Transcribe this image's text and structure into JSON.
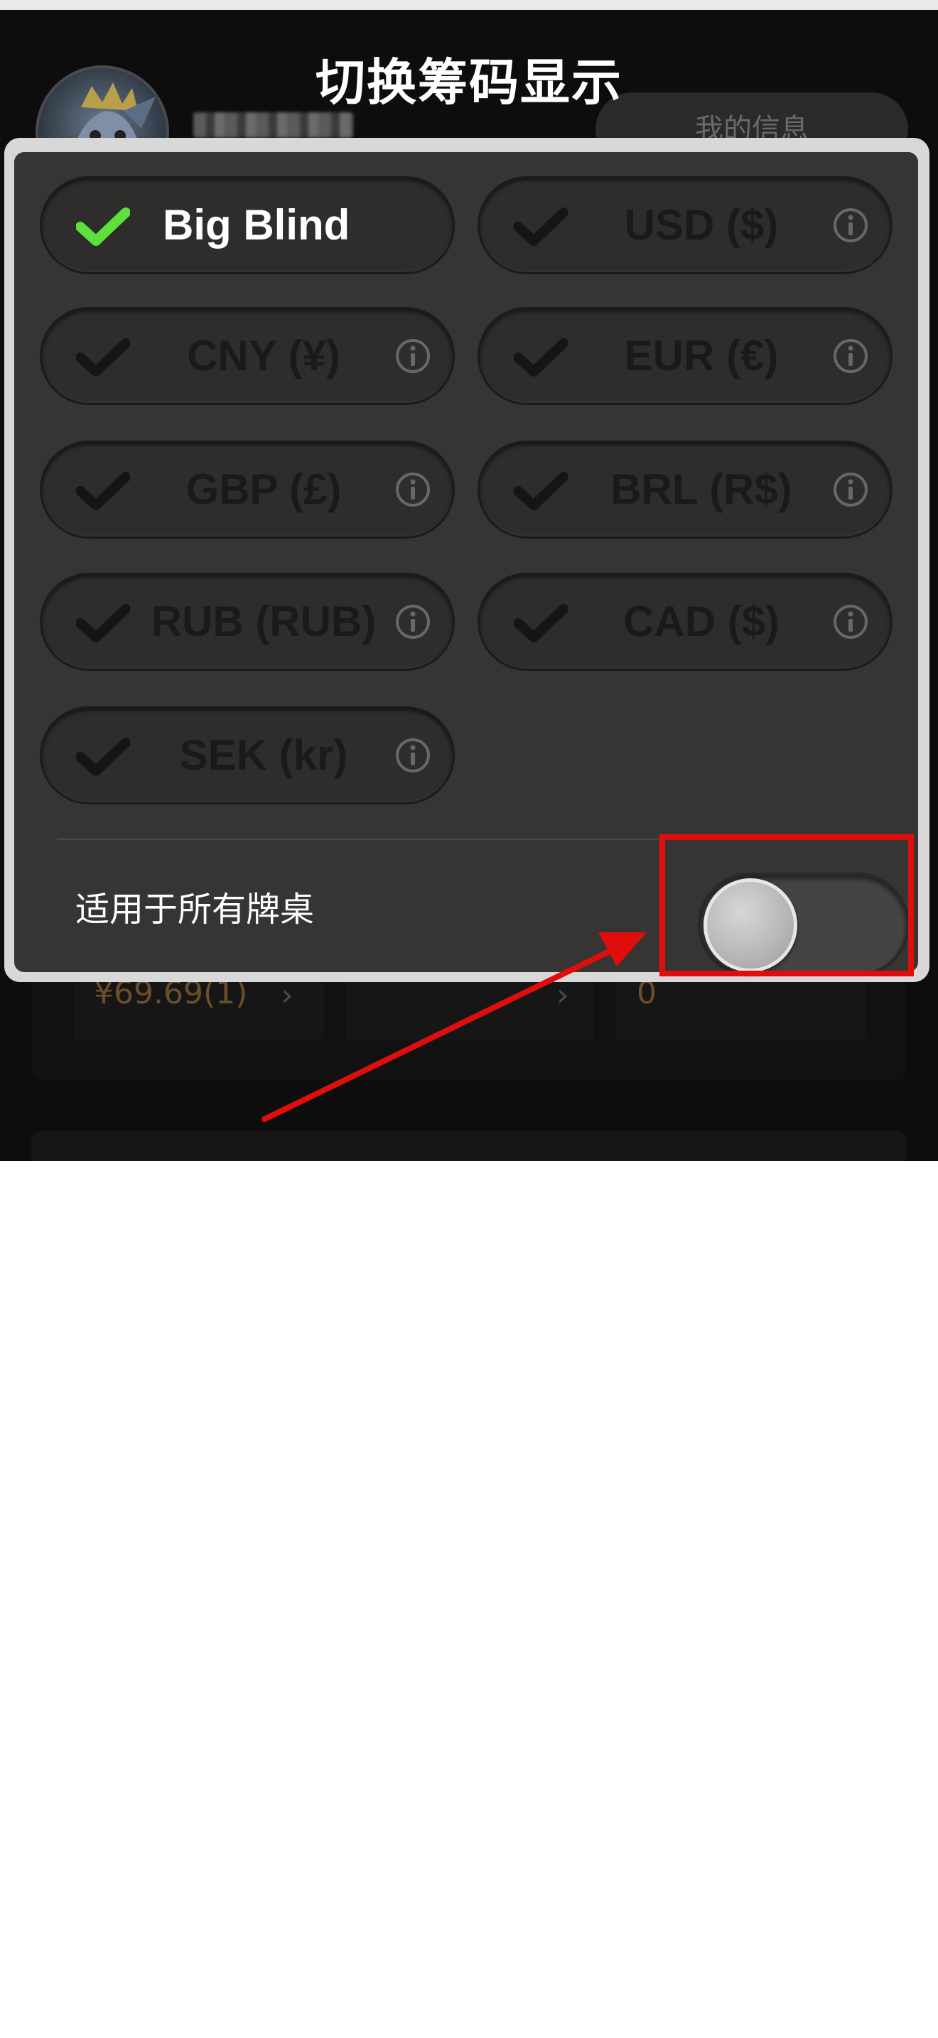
{
  "title": "切换筹码显示",
  "background": {
    "my_info_button": "我的信息",
    "cell_1_value": "¥69.69(1)",
    "cell_3_value": "0"
  },
  "options": [
    {
      "label": "Big Blind",
      "selected": true,
      "has_info": false
    },
    {
      "label": "USD ($)",
      "selected": false,
      "has_info": true
    },
    {
      "label": "CNY (¥)",
      "selected": false,
      "has_info": true
    },
    {
      "label": "EUR (€)",
      "selected": false,
      "has_info": true
    },
    {
      "label": "GBP (£)",
      "selected": false,
      "has_info": true
    },
    {
      "label": "BRL (R$)",
      "selected": false,
      "has_info": true
    },
    {
      "label": "RUB (RUB)",
      "selected": false,
      "has_info": true
    },
    {
      "label": "CAD ($)",
      "selected": false,
      "has_info": true
    },
    {
      "label": "SEK (kr)",
      "selected": false,
      "has_info": true
    }
  ],
  "apply_all": {
    "label": "适用于所有牌桌",
    "enabled": false
  },
  "colors": {
    "selected_check": "#5ee03a",
    "unselected_check": "#151515",
    "highlight": "#e00d0d",
    "dialog_bg": "#363534"
  },
  "icons": {
    "check": "check-icon",
    "info": "info-icon",
    "chevron": "chevron-right-icon"
  }
}
